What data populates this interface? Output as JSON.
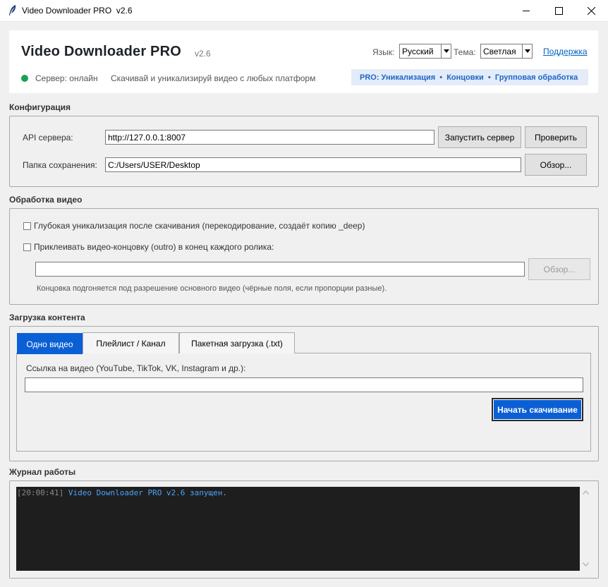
{
  "window": {
    "title": "Video Downloader PRO  v2.6"
  },
  "header": {
    "app_title": "Video Downloader PRO",
    "version": "v2.6",
    "language_label": "Язык:",
    "language_value": "Русский",
    "theme_label": "Тема:",
    "theme_value": "Светлая",
    "support_link": "Поддержка",
    "server_status": "Сервер: онлайн",
    "server_status_color": "#1aa050",
    "tagline": "Скачивай и уникализируй видео с любых платформ",
    "pro_banner": "PRO: Уникализация  •  Концовки  •  Групповая обработка"
  },
  "config": {
    "section_title": "Конфигурация",
    "api_label": "API сервера:",
    "api_value": "http://127.0.0.1:8007",
    "start_server_button": "Запустить сервер",
    "check_button": "Проверить",
    "folder_label": "Папка сохранения:",
    "folder_value": "C:/Users/USER/Desktop",
    "browse_button": "Обзор..."
  },
  "processing": {
    "section_title": "Обработка видео",
    "deep_unique_label": "Глубокая уникализация после скачивания (перекодирование, создаёт копию _deep)",
    "deep_unique_checked": false,
    "outro_label": "Приклеивать видео-концовку (outro) в конец каждого ролика:",
    "outro_checked": false,
    "outro_path_value": "",
    "outro_browse_button": "Обзор...",
    "outro_hint": "Концовка подгоняется под разрешение основного видео (чёрные поля, если пропорции разные)."
  },
  "download": {
    "section_title": "Загрузка контента",
    "tabs": [
      {
        "label": "Одно видео",
        "active": true
      },
      {
        "label": "Плейлист / Канал",
        "active": false
      },
      {
        "label": "Пакетная загрузка (.txt)",
        "active": false
      }
    ],
    "url_label": "Ссылка на видео (YouTube, TikTok, VK, Instagram и др.):",
    "url_value": "",
    "start_button": "Начать скачивание",
    "accent_color": "#0b5fd5"
  },
  "log": {
    "section_title": "Журнал работы",
    "lines": [
      {
        "timestamp": "[20:00:41]",
        "message": "Video Downloader PRO v2.6 запущен."
      }
    ]
  }
}
